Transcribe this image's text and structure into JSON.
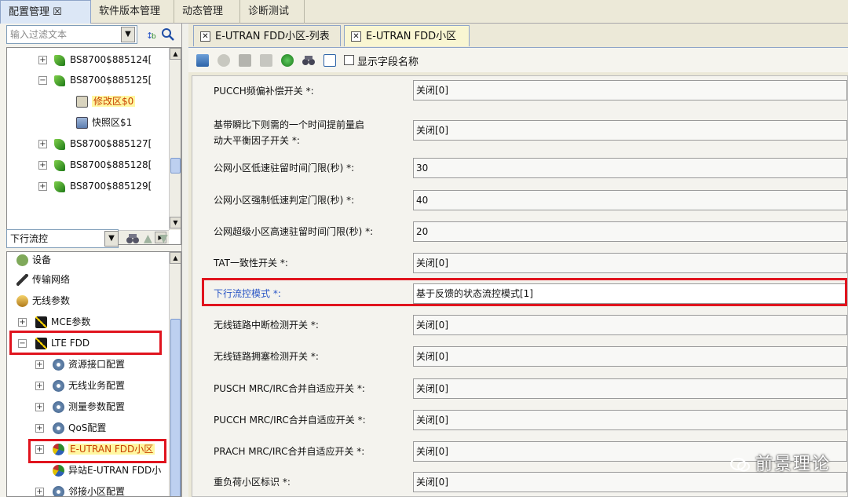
{
  "top_tabs": [
    "配置管理 ☒",
    "软件版本管理",
    "动态管理",
    "诊断测试"
  ],
  "left": {
    "filter_placeholder": "输入过滤文本",
    "upper_tree": [
      {
        "label": "BS8700$885124[",
        "icon": "leaf-icon"
      },
      {
        "label": "BS8700$885125[",
        "icon": "leaf-icon"
      },
      {
        "label": "修改区$0",
        "icon": "edit-area-icon"
      },
      {
        "label": "快照区$1",
        "icon": "snapshot-icon"
      },
      {
        "label": "BS8700$885127[",
        "icon": "leaf-icon"
      },
      {
        "label": "BS8700$885128[",
        "icon": "leaf-icon"
      },
      {
        "label": "BS8700$885129[",
        "icon": "leaf-icon"
      }
    ],
    "flow_select": "下行流控",
    "lower_tree": [
      {
        "label": "设备",
        "icon": "device-icon"
      },
      {
        "label": "传输网络",
        "icon": "transport-icon"
      },
      {
        "label": "无线参数",
        "icon": "wireless-icon"
      },
      {
        "label": "MCE参数",
        "icon": "mce-icon"
      },
      {
        "label": "LTE FDD",
        "icon": "lte-icon"
      },
      {
        "label": "资源接口配置",
        "icon": "resource-icon"
      },
      {
        "label": "无线业务配置",
        "icon": "service-icon"
      },
      {
        "label": "测量参数配置",
        "icon": "measure-icon"
      },
      {
        "label": "QoS配置",
        "icon": "qos-icon"
      },
      {
        "label": "E-UTRAN FDD小区",
        "icon": "globe-icon"
      },
      {
        "label": "异站E-UTRAN FDD小",
        "icon": "globe-icon"
      },
      {
        "label": "邻接小区配置",
        "icon": "neighbor-icon"
      }
    ]
  },
  "right": {
    "tabs": [
      "E-UTRAN FDD小区-列表",
      "E-UTRAN FDD小区"
    ],
    "show_field_names": "显示字段名称",
    "fields": [
      {
        "label": "PUCCH频偏补偿开关 *:",
        "value": "关闭[0]"
      },
      {
        "label": "基带瞬比下则需的一个时间提前量启",
        "label2": "动大平衡因子开关 *:",
        "value": "关闭[0]"
      },
      {
        "label": "公网小区低速驻留时间门限(秒) *:",
        "value": "30"
      },
      {
        "label": "公网小区强制低速判定门限(秒) *:",
        "value": "40"
      },
      {
        "label": "公网超级小区高速驻留时间门限(秒) *:",
        "value": "20"
      },
      {
        "label": "TAT一致性开关 *:",
        "value": "关闭[0]"
      },
      {
        "label": "下行流控模式 *:",
        "value": "基于反馈的状态流控模式[1]"
      },
      {
        "label": "无线链路中断检测开关 *:",
        "value": "关闭[0]"
      },
      {
        "label": "无线链路拥塞检测开关 *:",
        "value": "关闭[0]"
      },
      {
        "label": "PUSCH MRC/IRC合并自适应开关 *:",
        "value": "关闭[0]"
      },
      {
        "label": "PUCCH MRC/IRC合并自适应开关 *:",
        "value": "关闭[0]"
      },
      {
        "label": "PRACH MRC/IRC合并自适应开关 *:",
        "value": "关闭[0]"
      },
      {
        "label": "重负荷小区标识 *:",
        "value": "关闭[0]"
      }
    ]
  },
  "watermark": "前景理论",
  "colors": {
    "highlight": "#e0141e",
    "link_label": "#2a56c6",
    "tab_active": "#dce7f6"
  }
}
